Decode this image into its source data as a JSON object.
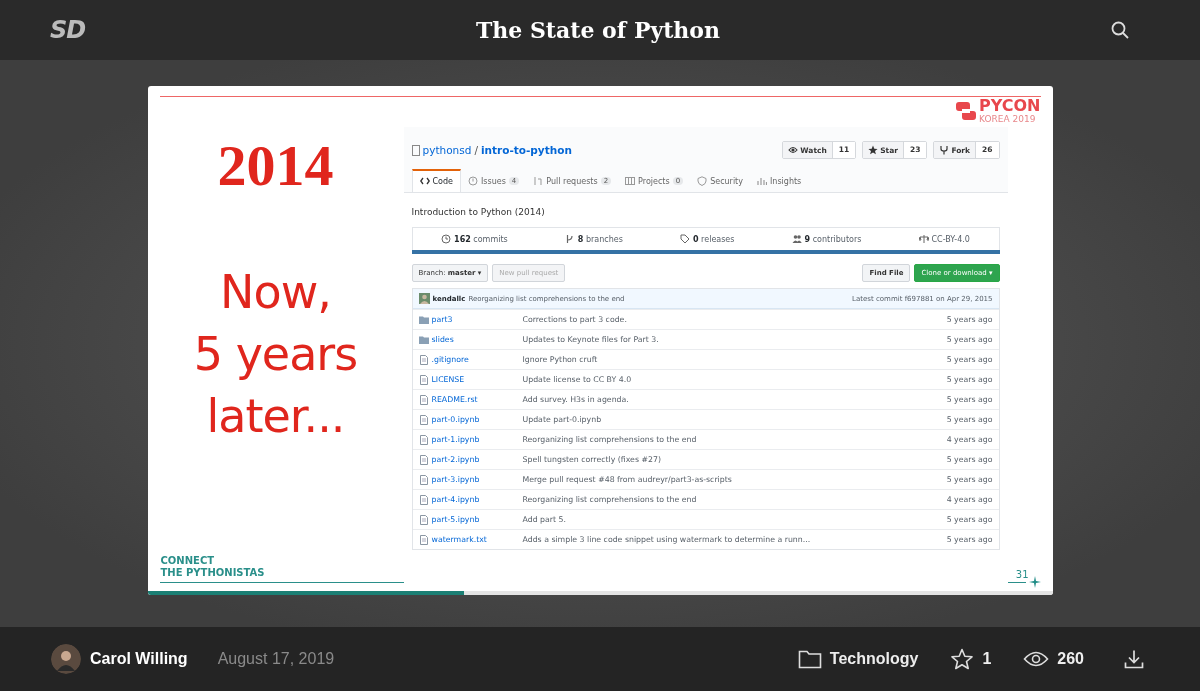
{
  "header": {
    "logo": "SD",
    "title": "The State of Python"
  },
  "slide": {
    "year": "2014",
    "headline": [
      "Now,",
      "5 years",
      "later..."
    ],
    "event_logo": {
      "name": "PYCON",
      "sub": "KOREA 2019"
    },
    "footer_brand": [
      "CONNECT",
      "THE PYTHONISTAS"
    ],
    "page_number": "31",
    "progress": {
      "level": 0.35
    },
    "repo": {
      "owner": "pythonsd",
      "separator": "/",
      "name": "intro-to-python",
      "actions": [
        {
          "label": "Watch",
          "count": "11",
          "kind": "eye"
        },
        {
          "label": "Star",
          "count": "23",
          "kind": "star"
        },
        {
          "label": "Fork",
          "count": "26",
          "kind": "fork"
        }
      ],
      "tabs": [
        {
          "label": "Code",
          "kind": "code",
          "selected": true
        },
        {
          "label": "Issues",
          "count": "4",
          "kind": "issue",
          "selected": false
        },
        {
          "label": "Pull requests",
          "count": "2",
          "kind": "pr",
          "selected": false
        },
        {
          "label": "Projects",
          "count": "0",
          "kind": "project",
          "selected": false
        },
        {
          "label": "Security",
          "kind": "shield",
          "selected": false
        },
        {
          "label": "Insights",
          "kind": "graph",
          "selected": false
        }
      ],
      "description": "Introduction to Python (2014)",
      "stats": [
        {
          "text": "**162** commits",
          "kind": "commit"
        },
        {
          "text": "**8** branches",
          "kind": "branch"
        },
        {
          "text": "**0** releases",
          "kind": "tag"
        },
        {
          "text": "**9** contributors",
          "kind": "people"
        },
        {
          "text": "CC-BY-4.0",
          "kind": "law"
        }
      ],
      "branch_button": "Branch: **master** ▾",
      "new_pr_button": {
        "label": "New pull request",
        "disabled": true
      },
      "find_file_button": "Find File",
      "clone_button": "Clone or download ▾",
      "commit": {
        "author": "kendallc",
        "message": "Reorganizing list comprehensions to the end",
        "latest": "Latest commit f697881 on Apr 29, 2015"
      },
      "files": [
        {
          "name": "part3",
          "kind": "folder",
          "message": "Corrections to part 3 code.",
          "age": "5 years ago"
        },
        {
          "name": "slides",
          "kind": "folder",
          "message": "Updates to Keynote files for Part 3.",
          "age": "5 years ago"
        },
        {
          "name": ".gitignore",
          "kind": "file",
          "message": "Ignore Python cruft",
          "age": "5 years ago"
        },
        {
          "name": "LICENSE",
          "kind": "file",
          "message": "Update license to CC BY 4.0",
          "age": "5 years ago"
        },
        {
          "name": "README.rst",
          "kind": "file",
          "message": "Add survey. H3s in agenda.",
          "age": "5 years ago"
        },
        {
          "name": "part-0.ipynb",
          "kind": "file",
          "message": "Update part-0.ipynb",
          "age": "5 years ago"
        },
        {
          "name": "part-1.ipynb",
          "kind": "file",
          "message": "Reorganizing list comprehensions to the end",
          "age": "4 years ago"
        },
        {
          "name": "part-2.ipynb",
          "kind": "file",
          "message": "Spell tungsten correctly (fixes #27)",
          "age": "5 years ago"
        },
        {
          "name": "part-3.ipynb",
          "kind": "file",
          "message": "Merge pull request #48 from audreyr/part3-as-scripts",
          "age": "5 years ago"
        },
        {
          "name": "part-4.ipynb",
          "kind": "file",
          "message": "Reorganizing list comprehensions to the end",
          "age": "4 years ago"
        },
        {
          "name": "part-5.ipynb",
          "kind": "file",
          "message": "Add part 5.",
          "age": "5 years ago"
        },
        {
          "name": "watermark.txt",
          "kind": "file",
          "message": "Adds a simple 3 line code snippet using watermark to determine a runn...",
          "age": "5 years ago"
        }
      ]
    }
  },
  "footer": {
    "author": "Carol Willing",
    "date": "August 17, 2019",
    "category": "Technology",
    "stars": "1",
    "views": "260"
  }
}
